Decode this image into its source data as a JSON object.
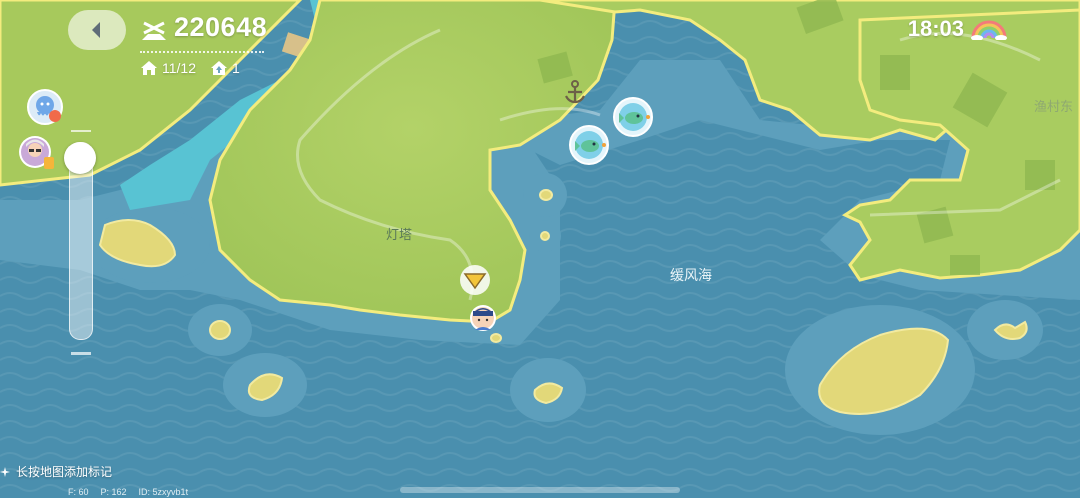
{
  "header": {
    "back_icon": "chevron-left-icon",
    "coins_icon": "windmill-icon",
    "coins_value": "220648",
    "homes_icon": "house-icon",
    "homes_value": "11/12",
    "rooms_icon": "house-upload-icon",
    "rooms_value": "1"
  },
  "status": {
    "time": "18:03",
    "weather_icon": "rainbow-icon"
  },
  "side_buttons": {
    "event_icon": "octopus-event-icon",
    "profile_icon": "player-avatar-icon"
  },
  "zoom": {
    "level": 0.0
  },
  "map": {
    "labels": {
      "lighthouse": "灯塔",
      "sea": "缓风海",
      "fishing_village": "渔村东"
    },
    "markers": {
      "anchor": "anchor-icon",
      "fish_spot": "fish-spot-icon",
      "player_direction": "direction-arrow-icon",
      "npc": "npc-avatar-icon"
    },
    "colors": {
      "sea": "#4a8fae",
      "shallow": "#5fa1be",
      "land": "#a9cc60",
      "border": "#f3ec7e",
      "sand": "#e5da7a",
      "river": "#58c3d3"
    }
  },
  "footer": {
    "hint": "长按地图添加标记",
    "debug_f": "F: 60",
    "debug_p": "P: 162",
    "debug_id": "ID: 5zxyvb1t"
  }
}
